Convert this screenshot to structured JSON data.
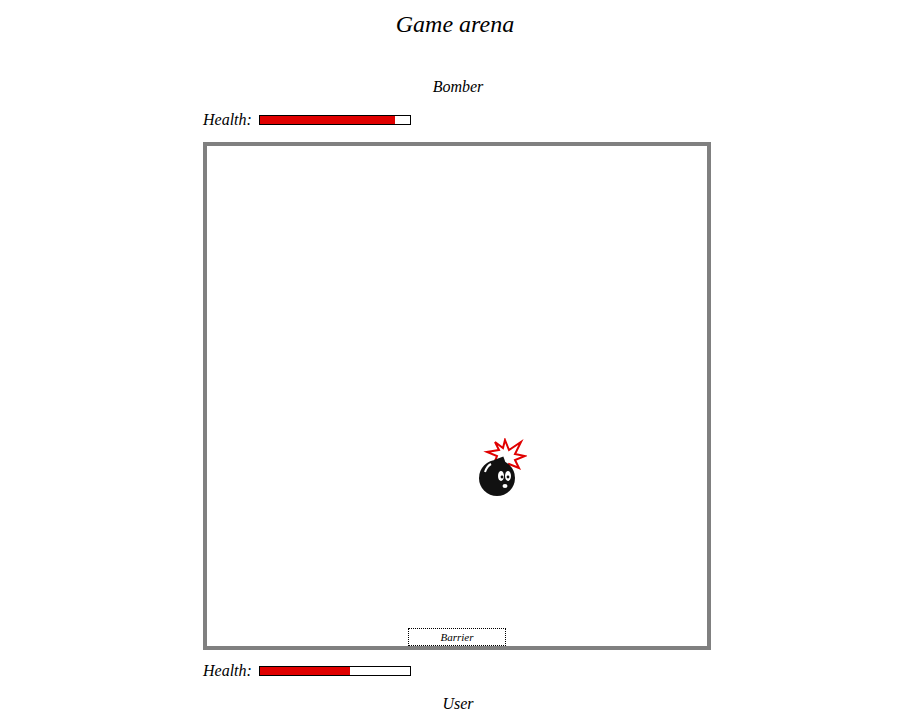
{
  "title": "Game arena",
  "bomber": {
    "name": "Bomber",
    "health_label": "Health:",
    "level": 0.9
  },
  "arena": {
    "barrier": "Barrier"
  },
  "user": {
    "name": "User",
    "health_label": "Health:",
    "level": 0.6
  }
}
